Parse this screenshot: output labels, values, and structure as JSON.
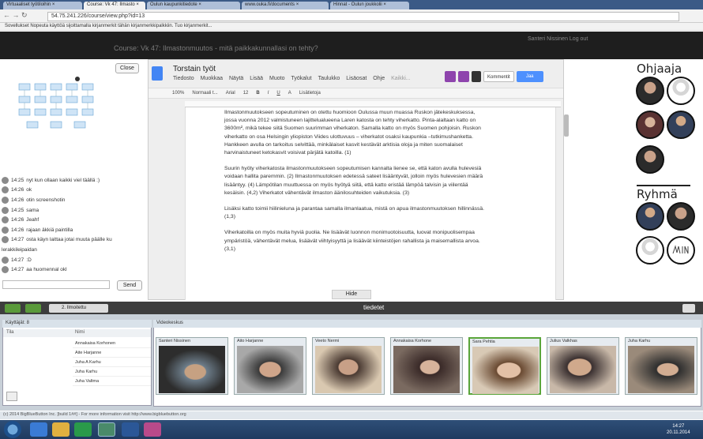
{
  "browser": {
    "tabs": [
      "Virtuaaliset työtiloihin ×",
      "Course: Vk 47: Ilmasto ×",
      "Oulun kaupunkitiedote ×",
      "www.ouka.fi/documents ×",
      "Hinnat - Oulun joukkolii ×"
    ],
    "url": "54.75.241.226/course/view.php?id=13",
    "bookmarks": "Sovellukset   Nopeuta käyttöä sijoittamalla kirjanmerkit tähän kirjanmerkkipalkkiin. Tuo kirjanmerkit..."
  },
  "moodle": {
    "course_title": "Course: Vk 47: Ilmastonmuutos - mitä paikkakunnallasi on tehty?",
    "user": "Santeri Nissinen   Log out"
  },
  "left_panel": {
    "close_label": "Close",
    "send_label": "Send",
    "chat": [
      {
        "time": "14:25",
        "text": "nyt kun ollaan kaikki viel täällä :)"
      },
      {
        "time": "14:26",
        "text": "ok"
      },
      {
        "time": "14:26",
        "text": "otin screenshotin"
      },
      {
        "time": "14:25",
        "text": "sama"
      },
      {
        "time": "14:26",
        "text": "Jeahf"
      },
      {
        "time": "14:26",
        "text": "rajaan äkkiä paintilla"
      },
      {
        "time": "14:27",
        "text": "osta käyn laittaa jotai muuta päälle ku"
      },
      {
        "time": "",
        "text": "lerakkileipaidan"
      },
      {
        "time": "14:27",
        "text": ":D"
      },
      {
        "time": "14:27",
        "text": "aa huomennal okl"
      }
    ]
  },
  "gdoc": {
    "title": "Torstain työt",
    "menu": [
      "Tiedosto",
      "Muokkaa",
      "Näytä",
      "Lisää",
      "Muoto",
      "Työkalut",
      "Taulukko",
      "Lisäosat",
      "Ohje",
      "Kaikki..."
    ],
    "comments_label": "Kommentit",
    "share_label": "Jaa",
    "toolbar": [
      "100%",
      "Normaali t...",
      "Arial",
      "12",
      "B",
      "I",
      "U",
      "A",
      "Lisätietoja"
    ],
    "paragraphs": [
      "Ilmastonmuutokseen sopeutuminen on otettu huomioon Oulussa muun muassa Ruskon jätekeskuksessa, jossa vuonna 2012 valmistuneen lajittelualueena Laren katosta on tehty viherkatto. Pinta-alaltaan katto on 3600m², mikä tekee siitä Suomen suurimman viherkaton. Samalla katto on myös Suomen pohjoisin. Ruskon viherkatto on osa Helsingin yliopiston Viides ulottuvuus – viherkatot osaksi kaupunkia –tutkimushanketta. Hankkeen avulla on tarkoitus selvittää, minkälaiset kasvit kestävät arktisia oloja ja miten suomalaiset harvinaistuneet ketokasvit voisivat pärjätä katoilla. (1)",
      "Suurin hyöty viherkatosta ilmastonmuutokseen sopeutumisen kannalta lienee se, että katon avulla hulevesiä voidaan hallita paremmin. (2) Ilmastonmuutoksen edetessä sateet lisääntyvät, jolloin myös hulevesien määrä lisääntyy. (4) Lämpötilan muuttuessa on myös hyötyä siitä, että katto eristää lämpöä talvisin ja viilentää kesäisin. (4,2) Viherkatot vähentävät ilmaston äänilosuhteiden vaikutuksia. (3)",
      "Lisäksi katto toimii hiilinieluna ja parantaa samalla ilmanlaatua, mistä on apua ilmastonmuutoksen hillinnässä. (1,3)",
      "Viherkatoilla on myös muita hyviä puolia. Ne lisäävät luonnon monimuotoisuutta, luovat monipuolisempaa ympäristöä, vähentävät melua, lisäävät viihtyisyyttä ja lisäävät kiinteistöjen rahallista ja maisemallista arvoa. (3,1)"
    ],
    "hide_label": "Hide"
  },
  "right_panel": {
    "ohjaaja_title": "Ohjaaja",
    "ryhma_title": "Ryhmä"
  },
  "lower": {
    "title": "tiedetet",
    "tab_label": "2. Ilmoitettu",
    "users_title": "Käyttäjät: 8",
    "col_tila": "Tila",
    "col_nimi": "Nimi",
    "users": [
      "Annakaisa Korhonen",
      "Aite Harjanne",
      "Juha A Karhu",
      "Juha Karhu",
      "Juha Valtma"
    ],
    "videos_title": "Videokeskus",
    "videos": [
      "Santeri Nissinen",
      "Aito Harjanne",
      "Veeto Nermi",
      "Annakaisa Korhone",
      "Sara Pehtia",
      "Julius Valkhas",
      "Juha Karhu"
    ],
    "footer": "(c) 2014 BigBlueButton Inc. [build 1##] - For more information visit http://www.bigbluebutton.org"
  },
  "taskbar": {
    "time": "14:27",
    "date": "20.11.2014"
  }
}
